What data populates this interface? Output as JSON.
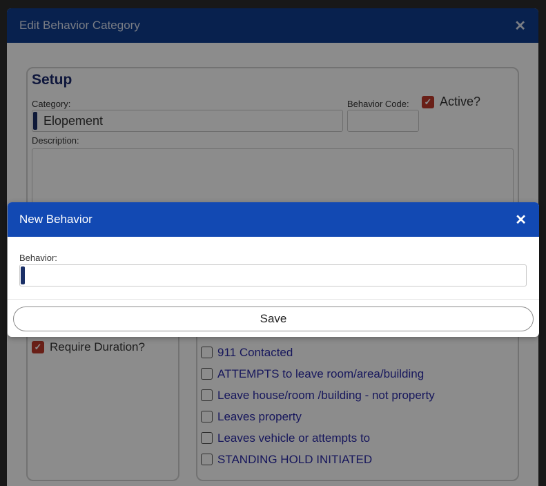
{
  "outer_dialog": {
    "title": "Edit Behavior Category",
    "close_glyph": "✕",
    "setup": {
      "title": "Setup",
      "category_label": "Category:",
      "category_value": "Elopement",
      "code_label": "Behavior Code:",
      "code_value": "",
      "active_label": "Active?",
      "active_checked": true,
      "description_label": "Description:",
      "description_value": ""
    },
    "require_duration_label": "Require Duration?",
    "require_duration_checked": true,
    "behaviors": [
      "911 Contacted",
      "ATTEMPTS to leave room/area/building",
      "Leave house/room /building - not property",
      "Leaves property",
      "Leaves vehicle or attempts to",
      "STANDING HOLD INITIATED"
    ]
  },
  "inner_dialog": {
    "title": "New Behavior",
    "close_glyph": "✕",
    "behavior_label": "Behavior:",
    "behavior_value": "",
    "save_label": "Save"
  },
  "colors": {
    "outer_header": "#0f3c8f",
    "inner_header": "#1249b3",
    "checkbox_checked": "#c0392b",
    "behavior_text": "#2a2aa8"
  }
}
